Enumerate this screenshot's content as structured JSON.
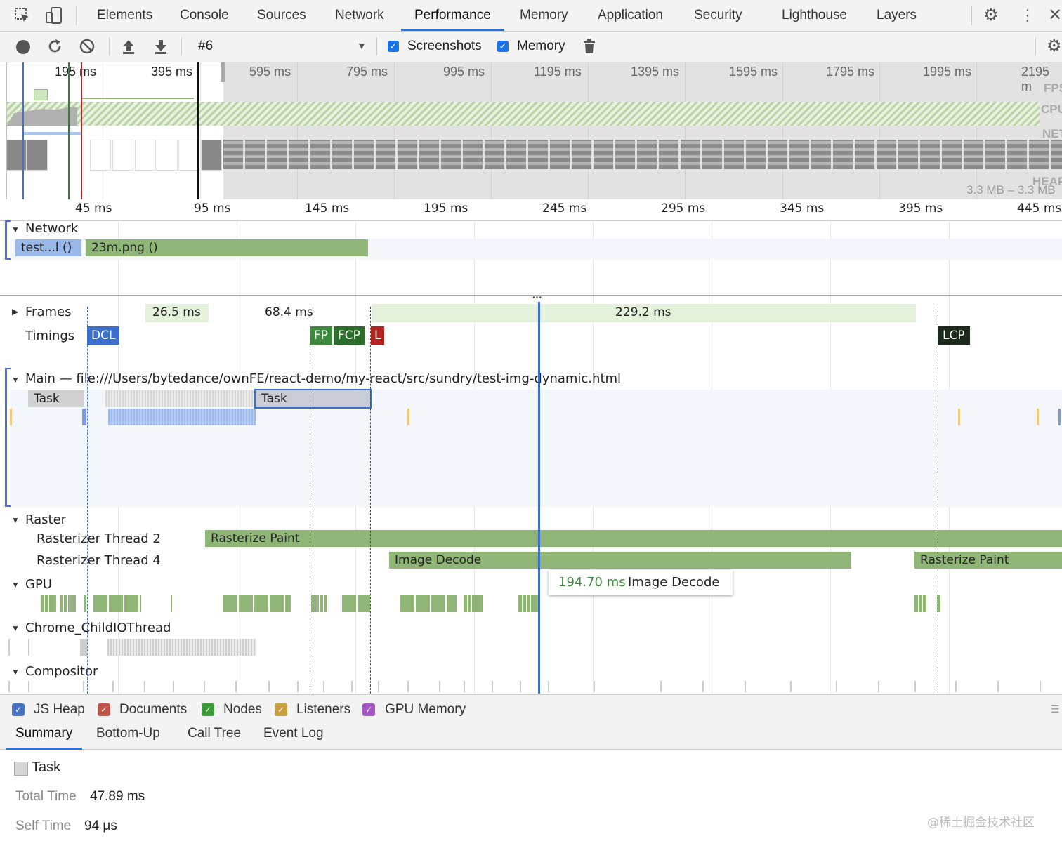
{
  "tabs": [
    {
      "label": "Elements"
    },
    {
      "label": "Console"
    },
    {
      "label": "Sources"
    },
    {
      "label": "Network"
    },
    {
      "label": "Performance"
    },
    {
      "label": "Memory"
    },
    {
      "label": "Application"
    },
    {
      "label": "Security"
    },
    {
      "label": "Lighthouse"
    },
    {
      "label": "Layers"
    }
  ],
  "active_tab": "Performance",
  "toolbar": {
    "recording": "#6",
    "screenshots_label": "Screenshots",
    "memory_label": "Memory",
    "screenshots_checked": true,
    "memory_checked": true
  },
  "overview": {
    "ticks": [
      "195 ms",
      "395 ms",
      "595 ms",
      "795 ms",
      "995 ms",
      "1195 ms",
      "1395 ms",
      "1595 ms",
      "1795 ms",
      "1995 ms",
      "2195 m"
    ],
    "labels": {
      "fps": "FPS",
      "cpu": "CPU",
      "net": "NET",
      "heap": "HEAP",
      "heap_range": "3.3 MB – 3.3 MB"
    }
  },
  "ruler": [
    "45 ms",
    "95 ms",
    "145 ms",
    "195 ms",
    "245 ms",
    "295 ms",
    "345 ms",
    "395 ms",
    "445 ms"
  ],
  "network": {
    "label": "Network",
    "requests": [
      {
        "label": "test...l ()"
      },
      {
        "label": "23m.png ()"
      }
    ]
  },
  "frames": {
    "label": "Frames",
    "items": [
      "26.5 ms",
      "68.4 ms",
      "229.2 ms"
    ]
  },
  "timings": {
    "label": "Timings",
    "markers": [
      "DCL",
      "FP",
      "FCP",
      "L",
      "LCP"
    ]
  },
  "main": {
    "label": "Main — file:///Users/bytedance/ownFE/react-demo/my-react/src/sundry/test-img-dynamic.html",
    "tasks": [
      "Task",
      "Task"
    ]
  },
  "raster": {
    "label": "Raster",
    "threads": [
      {
        "label": "Rasterizer Thread 2",
        "bars": [
          "Rasterize Paint"
        ]
      },
      {
        "label": "Rasterizer Thread 4",
        "bars": [
          "Image Decode",
          "Rasterize Paint"
        ]
      }
    ]
  },
  "tooltip": {
    "time": "194.70 ms",
    "name": "Image Decode"
  },
  "gpu": {
    "label": "GPU"
  },
  "childio": {
    "label": "Chrome_ChildIOThread"
  },
  "compositor": {
    "label": "Compositor"
  },
  "memory_legend": [
    {
      "label": "JS Heap",
      "color": "#4a72c4"
    },
    {
      "label": "Documents",
      "color": "#c2544a"
    },
    {
      "label": "Nodes",
      "color": "#3a9a3a"
    },
    {
      "label": "Listeners",
      "color": "#c9a040"
    },
    {
      "label": "GPU Memory",
      "color": "#a556c4"
    }
  ],
  "bottom_tabs": [
    {
      "label": "Summary"
    },
    {
      "label": "Bottom-Up"
    },
    {
      "label": "Call Tree"
    },
    {
      "label": "Event Log"
    }
  ],
  "summary": {
    "title": "Task",
    "total_label": "Total Time",
    "total_value": "47.89 ms",
    "self_label": "Self Time",
    "self_value": "94 μs"
  },
  "watermark": "@稀土掘金技术社区"
}
